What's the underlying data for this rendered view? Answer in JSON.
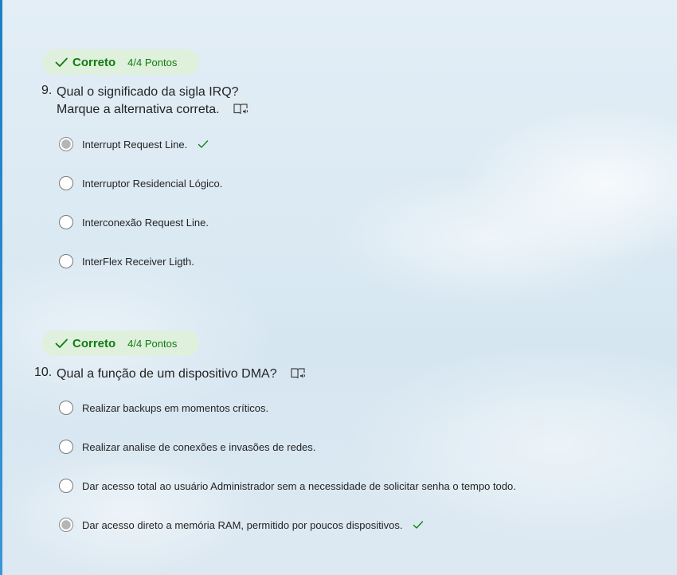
{
  "questions": [
    {
      "number": "9.",
      "status": "Correto",
      "points": "4/4 Pontos",
      "text_line1": "Qual o significado da sigla IRQ?",
      "text_line2": "Marque a alternativa correta.",
      "options": [
        {
          "label": "Interrupt Request Line.",
          "selected": true,
          "correct_mark": true
        },
        {
          "label": "Interruptor Residencial Lógico.",
          "selected": false
        },
        {
          "label": "Interconexão Request Line.",
          "selected": false
        },
        {
          "label": "InterFlex Receiver Ligth.",
          "selected": false
        }
      ]
    },
    {
      "number": "10.",
      "status": "Correto",
      "points": "4/4 Pontos",
      "text_line1": "Qual a função de um dispositivo DMA?",
      "options": [
        {
          "label": "Realizar backups em momentos críticos.",
          "selected": false
        },
        {
          "label": "Realizar analise de conexões e invasões de redes.",
          "selected": false
        },
        {
          "label": "Dar acesso total ao usuário Administrador sem a necessidade de solicitar senha o tempo todo.",
          "selected": false
        },
        {
          "label": "Dar acesso direto a memória RAM, permitido por poucos dispositivos.",
          "selected": true,
          "correct_mark": true
        }
      ]
    }
  ],
  "colors": {
    "correct_green": "#107c10",
    "badge_bg": "#dff0dd",
    "accent_edge": "#1e7fc4"
  },
  "icons": {
    "status": "check-icon",
    "immersive_reader": "immersive-reader-icon",
    "answer_mark": "check-icon"
  }
}
